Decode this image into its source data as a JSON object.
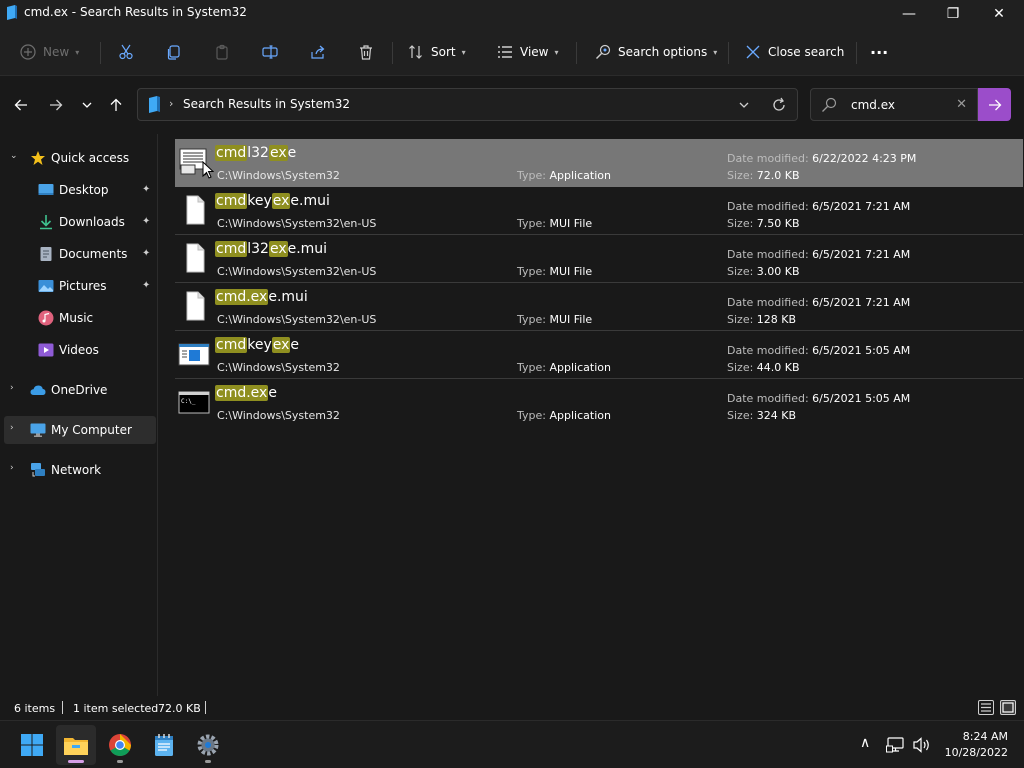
{
  "window": {
    "title": "cmd.ex - Search Results in System32",
    "minimize": "—",
    "maximize": "❐",
    "close": "✕"
  },
  "toolbar": {
    "new_label": "New",
    "sort_label": "Sort",
    "view_label": "View",
    "search_options_label": "Search options",
    "close_search_label": "Close search",
    "more_label": "···"
  },
  "address": {
    "path": "Search Results in System32",
    "separator": "›"
  },
  "search": {
    "value": "cmd.ex",
    "clear": "✕"
  },
  "sidebar": {
    "items": [
      {
        "label": "Quick access",
        "expander": "⌄"
      },
      {
        "label": "Desktop",
        "pin": "📌"
      },
      {
        "label": "Downloads",
        "pin": "📌"
      },
      {
        "label": "Documents",
        "pin": "📌"
      },
      {
        "label": "Pictures",
        "pin": "📌"
      },
      {
        "label": "Music"
      },
      {
        "label": "Videos"
      },
      {
        "label": "OneDrive",
        "expander": "›"
      },
      {
        "label": "My Computer",
        "expander": "›"
      },
      {
        "label": "Network",
        "expander": "›"
      }
    ]
  },
  "labels": {
    "type": "Type:",
    "date": "Date modified:",
    "size": "Size:"
  },
  "results": [
    {
      "name_parts": [
        {
          "t": "cmd",
          "h": true
        },
        {
          "t": "l32",
          "h": false
        },
        {
          "t": "ex",
          "h": true
        },
        {
          "t": "e",
          "h": false
        }
      ],
      "path": "C:\\Windows\\System32",
      "type": "Application",
      "date": "6/22/2022 4:23 PM",
      "size": "72.0 KB",
      "icon": "cmdl32-icon",
      "selected": true
    },
    {
      "name_parts": [
        {
          "t": "cmd",
          "h": true
        },
        {
          "t": "key",
          "h": false
        },
        {
          "t": "ex",
          "h": true
        },
        {
          "t": "e.mui",
          "h": false
        }
      ],
      "path": "C:\\Windows\\System32\\en-US",
      "type": "MUI File",
      "date": "6/5/2021 7:21 AM",
      "size": "7.50 KB",
      "icon": "file-icon",
      "selected": false
    },
    {
      "name_parts": [
        {
          "t": "cmd",
          "h": true
        },
        {
          "t": "l32",
          "h": false
        },
        {
          "t": "ex",
          "h": true
        },
        {
          "t": "e.mui",
          "h": false
        }
      ],
      "path": "C:\\Windows\\System32\\en-US",
      "type": "MUI File",
      "date": "6/5/2021 7:21 AM",
      "size": "3.00 KB",
      "icon": "file-icon",
      "selected": false
    },
    {
      "name_parts": [
        {
          "t": "cmd.ex",
          "h": true
        },
        {
          "t": "e.mui",
          "h": false
        }
      ],
      "path": "C:\\Windows\\System32\\en-US",
      "type": "MUI File",
      "date": "6/5/2021 7:21 AM",
      "size": "128 KB",
      "icon": "file-icon",
      "selected": false
    },
    {
      "name_parts": [
        {
          "t": "cmd",
          "h": true
        },
        {
          "t": "key",
          "h": false
        },
        {
          "t": "ex",
          "h": true
        },
        {
          "t": "e",
          "h": false
        }
      ],
      "path": "C:\\Windows\\System32",
      "type": "Application",
      "date": "6/5/2021 5:05 AM",
      "size": "44.0 KB",
      "icon": "cmdkey-icon",
      "selected": false
    },
    {
      "name_parts": [
        {
          "t": "cmd.ex",
          "h": true
        },
        {
          "t": "e",
          "h": false
        }
      ],
      "path": "C:\\Windows\\System32",
      "type": "Application",
      "date": "6/5/2021 5:05 AM",
      "size": "324 KB",
      "icon": "console-icon",
      "selected": false
    }
  ],
  "status": {
    "count": "6 items",
    "selected": "1 item selected",
    "selected_size": "72.0 KB"
  },
  "taskbar": {
    "apps": [
      "start-icon",
      "file-explorer-icon",
      "chrome-icon",
      "notepad-icon",
      "settings-icon"
    ],
    "time": "8:24 AM",
    "date": "10/28/2022",
    "tray_chevron": "∧"
  },
  "colors": {
    "accent": "#9b4dca",
    "highlight": "#8f8f20",
    "selected_row": "#777777",
    "background": "#191919"
  }
}
